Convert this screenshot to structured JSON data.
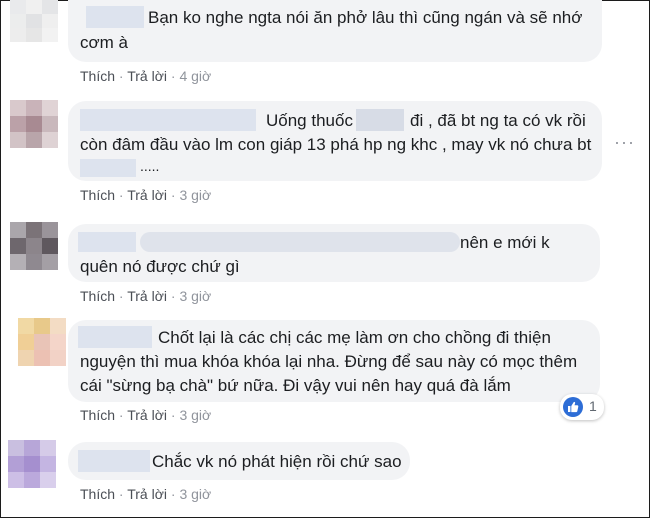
{
  "comments": [
    {
      "text_line1": "Bạn ko nghe ngta nói ăn phở lâu thì cũng ngán và sẽ nhớ",
      "text_line2": "cơm à",
      "like": "Thích",
      "reply": "Trả lời",
      "time": "4 giờ"
    },
    {
      "text_line1a": "Uống thuốc",
      "text_line1b": "đi , đã bt ng ta có vk rồi",
      "text_line2": "còn đâm đầu vào lm con giáp 13 phá hp ng khc , may vk nó chưa bt",
      "text_line3": ".....",
      "like": "Thích",
      "reply": "Trả lời",
      "time": "3 giờ",
      "more_icon": "···"
    },
    {
      "text_line1": "nên e mới k",
      "text_line2": "quên nó được chứ gì",
      "like": "Thích",
      "reply": "Trả lời",
      "time": "3 giờ"
    },
    {
      "text_line1": "Chốt lại là các chị các mẹ làm ơn cho chồng đi thiện",
      "text_line2": "nguyện thì mua khóa khóa lại nha. Đừng để sau này có mọc thêm",
      "text_line3": "cái \"sừng bạ chà\" bứ nữa. Đi vậy vui nên hay quá đà lắm",
      "like": "Thích",
      "reply": "Trả lời",
      "time": "3 giờ",
      "reaction_icon": "like-icon",
      "reaction_count": "1"
    },
    {
      "text_line1": "Chắc vk nó phát hiện rồi chứ sao",
      "like": "Thích",
      "reply": "Trả lời",
      "time": "3 giờ"
    }
  ],
  "colors": {
    "bubble": "#f2f3f5",
    "action_text": "#4b4f56",
    "meta_text": "#90949c",
    "like_blue": "#2d6dd6"
  }
}
